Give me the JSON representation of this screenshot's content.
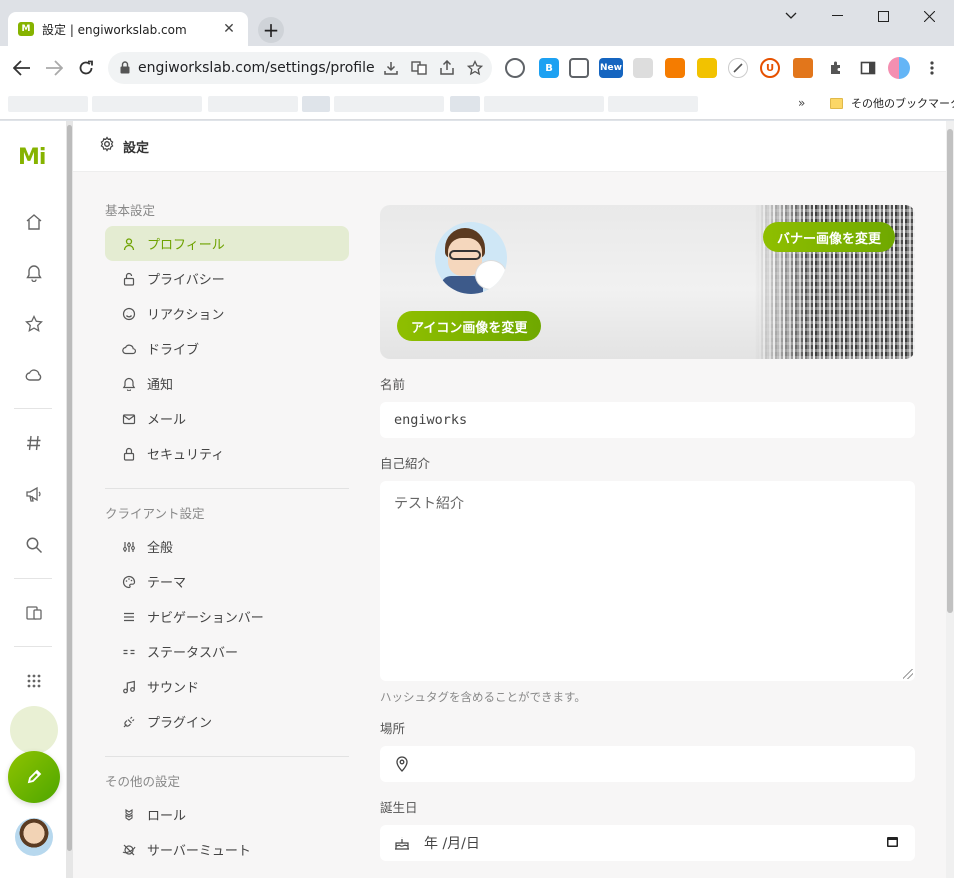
{
  "browser": {
    "tab_title": "設定 | engiworkslab.com",
    "tab_close": "✕",
    "new_tab": "+",
    "url": "engiworkslab.com/settings/profile",
    "extensions": [
      {
        "name": "line",
        "label": "",
        "color": "#5f6368"
      },
      {
        "name": "bitly",
        "label": "B",
        "color": "#1da1f2"
      },
      {
        "name": "copilot",
        "label": "",
        "color": "#5f6368"
      },
      {
        "name": "new",
        "label": "New",
        "color": "#1565c0"
      },
      {
        "name": "screenshot",
        "label": "",
        "color": "#8a8a8a"
      },
      {
        "name": "analytics",
        "label": "",
        "color": "#f57c00"
      },
      {
        "name": "translate",
        "label": "",
        "color": "#f2c200"
      },
      {
        "name": "tools",
        "label": "",
        "color": "#5f6368"
      },
      {
        "name": "ublock",
        "label": "U",
        "color": "#e65100"
      },
      {
        "name": "metamask",
        "label": "",
        "color": "#e2761b"
      }
    ],
    "bookmarks_more": "»",
    "bookmarks_other": "その他のブックマーク"
  },
  "app": {
    "logo": "Mi",
    "header_title": "設定"
  },
  "menu": {
    "basic_title": "基本設定",
    "basic_items": [
      {
        "label": "プロフィール",
        "icon": "user-icon",
        "active": true
      },
      {
        "label": "プライバシー",
        "icon": "lock-open-icon",
        "active": false
      },
      {
        "label": "リアクション",
        "icon": "mood-icon",
        "active": false
      },
      {
        "label": "ドライブ",
        "icon": "cloud-icon",
        "active": false
      },
      {
        "label": "通知",
        "icon": "bell-icon",
        "active": false
      },
      {
        "label": "メール",
        "icon": "mail-icon",
        "active": false
      },
      {
        "label": "セキュリティ",
        "icon": "lock-icon",
        "active": false
      }
    ],
    "client_title": "クライアント設定",
    "client_items": [
      {
        "label": "全般",
        "icon": "adjustments-icon"
      },
      {
        "label": "テーマ",
        "icon": "palette-icon"
      },
      {
        "label": "ナビゲーションバー",
        "icon": "list-icon"
      },
      {
        "label": "ステータスバー",
        "icon": "status-bar-icon"
      },
      {
        "label": "サウンド",
        "icon": "music-icon"
      },
      {
        "label": "プラグイン",
        "icon": "plug-icon"
      }
    ],
    "other_title": "その他の設定",
    "other_items": [
      {
        "label": "ロール",
        "icon": "badges-icon"
      },
      {
        "label": "サーバーミュート",
        "icon": "planet-off-icon"
      }
    ]
  },
  "profile": {
    "banner_button": "バナー画像を変更",
    "avatar_button": "アイコン画像を変更",
    "name_label": "名前",
    "name_value": "engiworks",
    "bio_label": "自己紹介",
    "bio_value": "テスト紹介",
    "bio_hint": "ハッシュタグを含めることができます。",
    "location_label": "場所",
    "location_value": "",
    "birthday_label": "誕生日",
    "birthday_placeholder": "年 /月/日"
  },
  "colors": {
    "accent": "#86b300",
    "active_bg": "#e4ecd2"
  }
}
